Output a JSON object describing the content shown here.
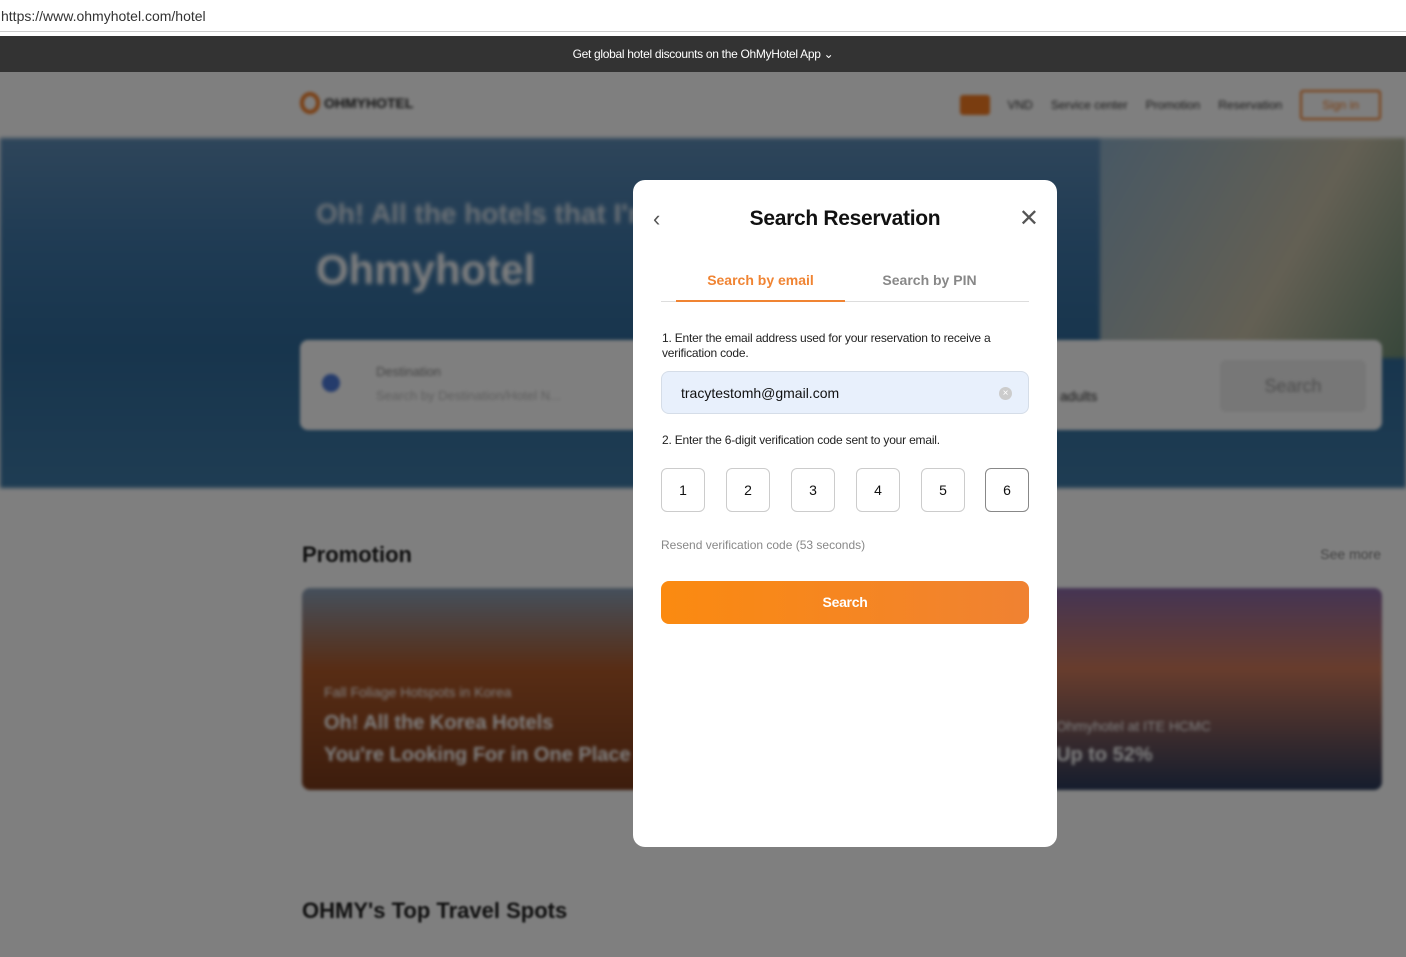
{
  "browser": {
    "url": "https://www.ohmyhotel.com/hotel"
  },
  "banner": {
    "text": "Get global hotel discounts on the OhMyHotel App ⌄"
  },
  "header": {
    "logo": "OHMYHOTEL",
    "currency": "VND",
    "nav": [
      "Service center",
      "Promotion",
      "Reservation"
    ],
    "signin": "Sign in"
  },
  "hero": {
    "subtitle": "Oh! All the hotels that I'm",
    "title": "Ohmyhotel",
    "destination_label": "Destination",
    "destination_placeholder": "Search by Destination/Hotel N...",
    "guests": "adults",
    "search": "Search"
  },
  "promotion": {
    "title": "Promotion",
    "see_more": "See more",
    "cards": [
      {
        "tag": "Fall Foliage Hotspots in Korea",
        "line1": "Oh! All the Korea Hotels",
        "line2": "You're Looking For in One Place"
      },
      {
        "tag": "Ohmyhotel at ITE HCMC",
        "line2": "Up to 52%"
      }
    ]
  },
  "spots": {
    "title": "OHMY's Top Travel Spots"
  },
  "modal": {
    "title": "Search Reservation",
    "tabs": [
      "Search by email",
      "Search by PIN"
    ],
    "step1": "1. Enter the email address used for your reservation to receive a verification code.",
    "email": "tracytestomh@gmail.com",
    "step2": "2. Enter the 6-digit verification code sent to your email.",
    "code": [
      "1",
      "2",
      "3",
      "4",
      "5",
      "6"
    ],
    "resend": "Resend verification code (53  seconds)",
    "search": "Search"
  },
  "colors": {
    "accent": "#f08433"
  }
}
